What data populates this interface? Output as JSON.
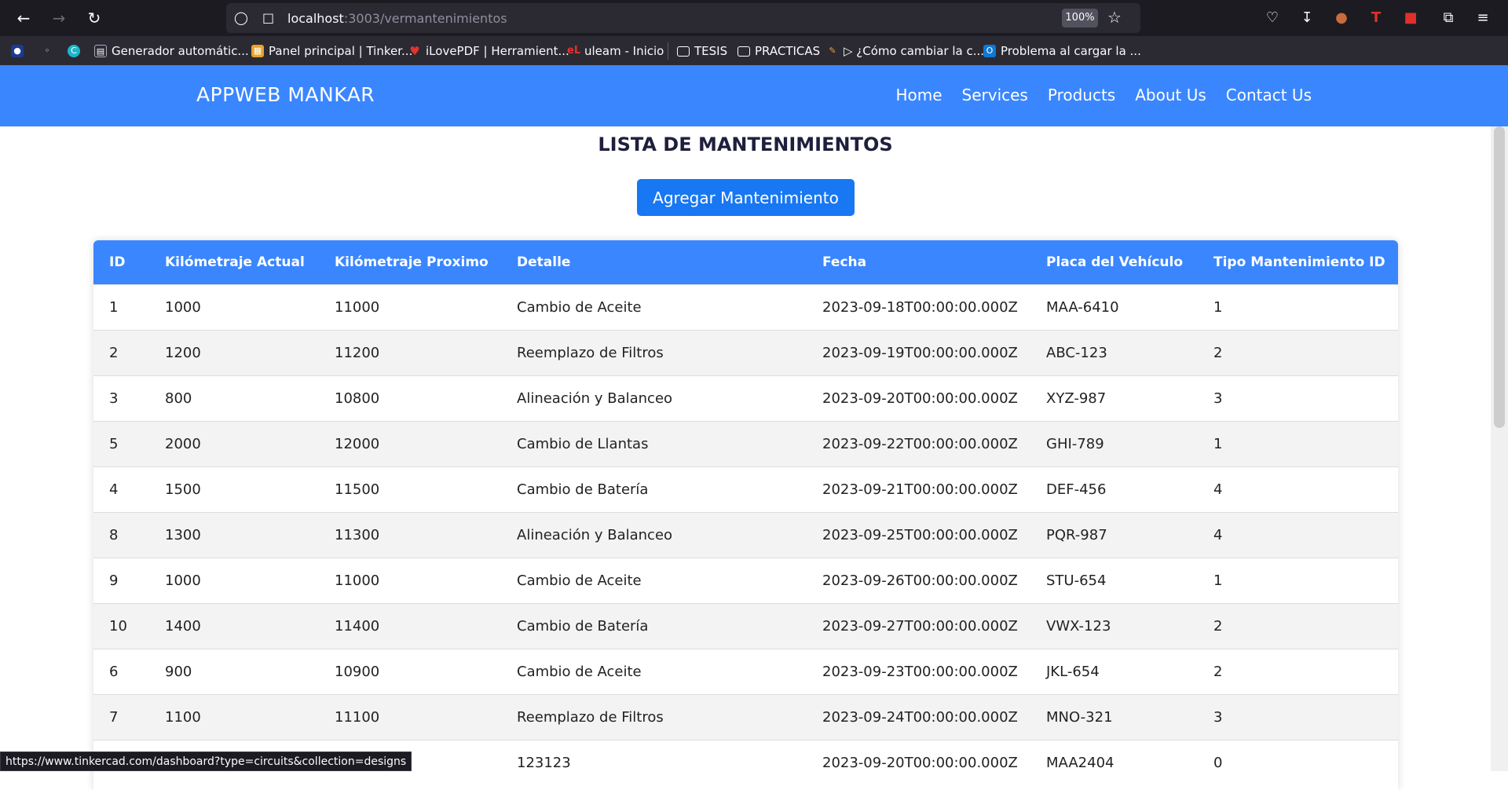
{
  "browser": {
    "url_host": "localhost",
    "url_path": ":3003/vermantenimientos",
    "zoom": "100%",
    "status_url": "https://www.tinkercad.com/dashboard?type=circuits&collection=designs"
  },
  "bookmarks": [
    {
      "label": "",
      "icon": "globe-icon"
    },
    {
      "label": "",
      "icon": "gauge-icon"
    },
    {
      "label": "",
      "icon": "canva-icon"
    },
    {
      "label": "Generador automátic...",
      "icon": "doc-icon"
    },
    {
      "label": "Panel principal | Tinker...",
      "icon": "tinkercad-icon"
    },
    {
      "label": "iLovePDF | Herramient...",
      "icon": "heart-icon"
    },
    {
      "label": "uleam - Inicio",
      "icon": "uleam-icon"
    },
    {
      "label": "TESIS",
      "icon": "folder-icon"
    },
    {
      "label": "PRACTICAS",
      "icon": "folder-icon"
    },
    {
      "label": "▷ ¿Cómo cambiar la c...",
      "icon": "pencil-icon"
    },
    {
      "label": "Problema al cargar la ...",
      "icon": "outlook-icon"
    }
  ],
  "navbar": {
    "brand": "APPWEB MANKAR",
    "links": [
      "Home",
      "Services",
      "Products",
      "About Us",
      "Contact Us"
    ]
  },
  "page": {
    "title": "LISTA DE MANTENIMIENTOS",
    "add_button": "Agregar Mantenimiento"
  },
  "table": {
    "headers": [
      "ID",
      "Kilómetraje Actual",
      "Kilómetraje Proximo",
      "Detalle",
      "Fecha",
      "Placa del Vehículo",
      "Tipo Mantenimiento ID"
    ],
    "rows": [
      [
        "1",
        "1000",
        "11000",
        "Cambio de Aceite",
        "2023-09-18T00:00:00.000Z",
        "MAA-6410",
        "1"
      ],
      [
        "2",
        "1200",
        "11200",
        "Reemplazo de Filtros",
        "2023-09-19T00:00:00.000Z",
        "ABC-123",
        "2"
      ],
      [
        "3",
        "800",
        "10800",
        "Alineación y Balanceo",
        "2023-09-20T00:00:00.000Z",
        "XYZ-987",
        "3"
      ],
      [
        "5",
        "2000",
        "12000",
        "Cambio de Llantas",
        "2023-09-22T00:00:00.000Z",
        "GHI-789",
        "1"
      ],
      [
        "4",
        "1500",
        "11500",
        "Cambio de Batería",
        "2023-09-21T00:00:00.000Z",
        "DEF-456",
        "4"
      ],
      [
        "8",
        "1300",
        "11300",
        "Alineación y Balanceo",
        "2023-09-25T00:00:00.000Z",
        "PQR-987",
        "4"
      ],
      [
        "9",
        "1000",
        "11000",
        "Cambio de Aceite",
        "2023-09-26T00:00:00.000Z",
        "STU-654",
        "1"
      ],
      [
        "10",
        "1400",
        "11400",
        "Cambio de Batería",
        "2023-09-27T00:00:00.000Z",
        "VWX-123",
        "2"
      ],
      [
        "6",
        "900",
        "10900",
        "Cambio de Aceite",
        "2023-09-23T00:00:00.000Z",
        "JKL-654",
        "2"
      ],
      [
        "7",
        "1100",
        "11100",
        "Reemplazo de Filtros",
        "2023-09-24T00:00:00.000Z",
        "MNO-321",
        "3"
      ],
      [
        "",
        "",
        "",
        "123123",
        "2023-09-20T00:00:00.000Z",
        "MAA2404",
        "0"
      ]
    ]
  }
}
